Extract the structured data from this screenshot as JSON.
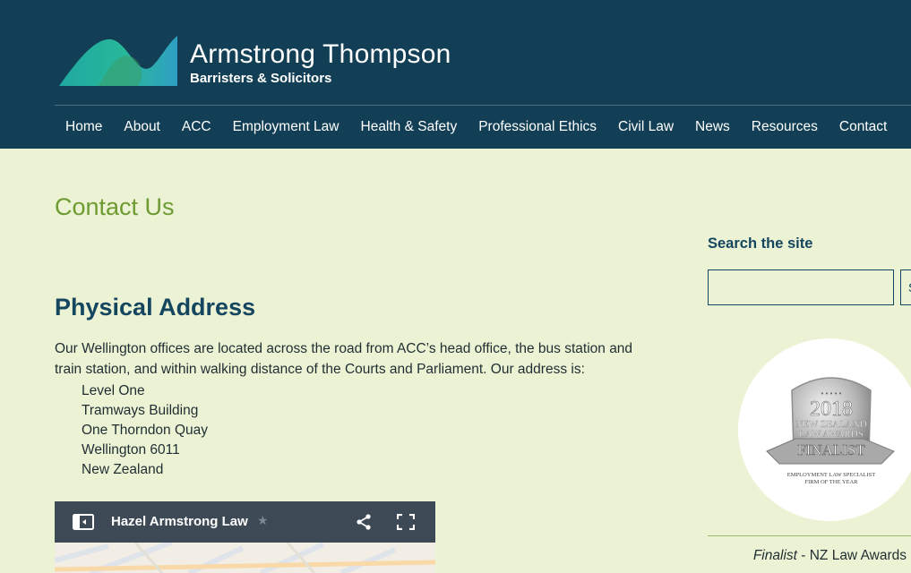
{
  "brand": {
    "name": "Armstrong Thompson",
    "tagline": "Barristers & Solicitors",
    "colors": {
      "header_bg": "#123f55",
      "accent_green": "#6e9a32",
      "heading_blue": "#154660",
      "page_bg": "#ecf3d4"
    }
  },
  "nav": {
    "items": [
      {
        "label": "Home"
      },
      {
        "label": "About"
      },
      {
        "label": "ACC"
      },
      {
        "label": "Employment Law"
      },
      {
        "label": "Health & Safety"
      },
      {
        "label": "Professional Ethics"
      },
      {
        "label": "Civil Law"
      },
      {
        "label": "News"
      },
      {
        "label": "Resources"
      },
      {
        "label": "Contact"
      }
    ]
  },
  "main": {
    "page_title": "Contact Us",
    "section_title": "Physical Address",
    "intro": "Our Wellington offices are located across the road from ACC’s head office, the bus station and train station, and within walking distance of the Courts and Parliament. Our address is:",
    "address_lines": [
      "Level One",
      "Tramways Building",
      "One Thorndon Quay",
      "Wellington 6011",
      "New Zealand"
    ],
    "map": {
      "title": "Hazel Armstrong Law",
      "icons": [
        "side-panel-icon",
        "star-icon",
        "share-icon",
        "fullscreen-icon"
      ]
    }
  },
  "sidebar": {
    "search_label": "Search the site",
    "search_placeholder": "",
    "search_button": "S",
    "award": {
      "year": "2018",
      "line1": "NEW ZEALAND",
      "line2": "LAW AWARDS",
      "ribbon": "FINALIST",
      "sub1": "EMPLOYMENT LAW SPECIALIST",
      "sub2": "FIRM OF THE YEAR"
    },
    "caption_em": "Finalist",
    "caption_rest": " - NZ Law Awards"
  }
}
